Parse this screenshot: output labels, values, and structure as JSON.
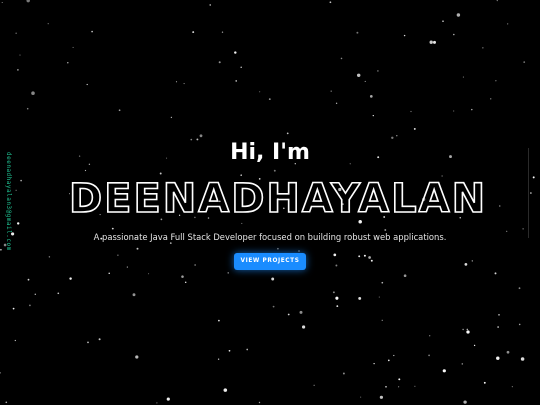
{
  "hero": {
    "greeting": "Hi, I'm",
    "name": "DEENADHAYALAN",
    "tagline": "A passionate Java Full Stack Developer focused on building robust web applications.",
    "cta_label": "VIEW PROJECTS"
  },
  "sidebar": {
    "email": "deenadhayalan3@gmail.com"
  },
  "colors": {
    "background": "#000000",
    "accent": "#1a8cff",
    "email": "#20c997",
    "text": "#ffffff"
  }
}
